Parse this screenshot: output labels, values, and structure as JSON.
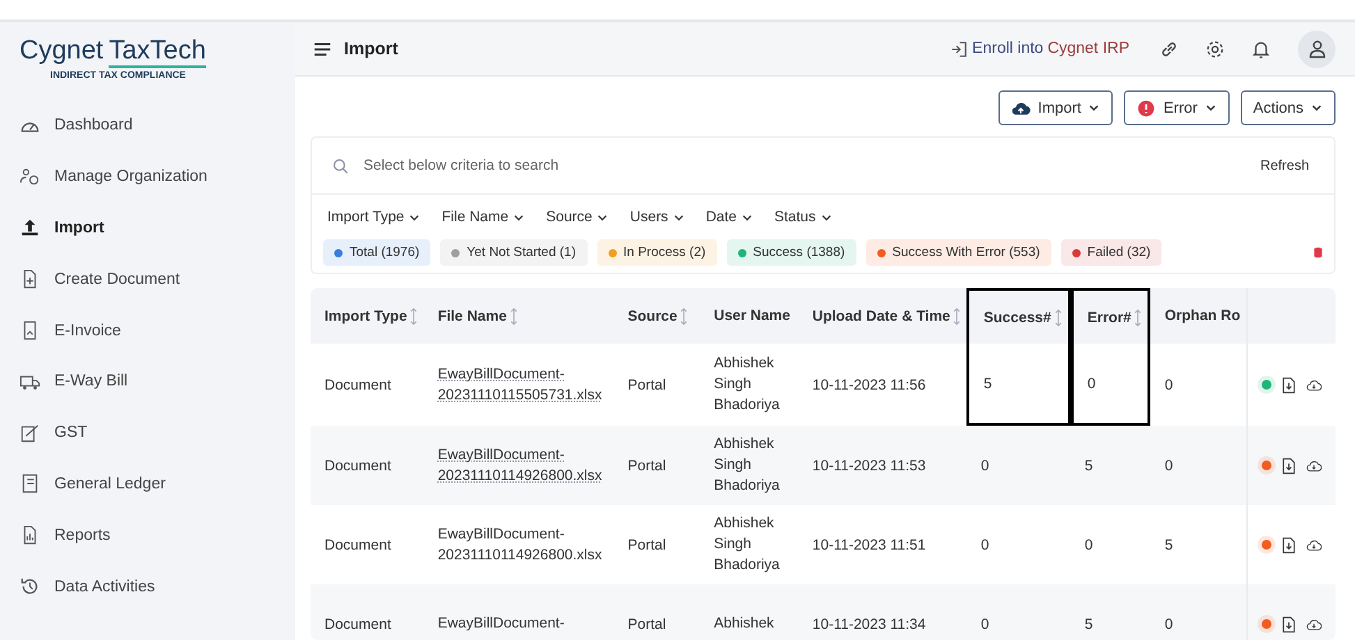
{
  "brand": {
    "name_dark": "Cygnet",
    "name_light": "TaxTech",
    "tagline": "INDIRECT TAX COMPLIANCE"
  },
  "sidebar": {
    "items": [
      {
        "label": "Dashboard",
        "selected": false
      },
      {
        "label": "Manage Organization",
        "selected": false
      },
      {
        "label": "Import",
        "selected": true
      },
      {
        "label": "Create Document",
        "selected": false
      },
      {
        "label": "E-Invoice",
        "selected": false
      },
      {
        "label": "E-Way Bill",
        "selected": false
      },
      {
        "label": "GST",
        "selected": false
      },
      {
        "label": "General Ledger",
        "selected": false
      },
      {
        "label": "Reports",
        "selected": false
      },
      {
        "label": "Data Activities",
        "selected": false
      }
    ]
  },
  "header": {
    "title": "Import",
    "enroll_prefix": "Enroll into",
    "enroll_brand": "Cygnet IRP"
  },
  "toolbar": {
    "buttons": [
      {
        "label": "Import",
        "kind": "upload"
      },
      {
        "label": "Error",
        "kind": "error"
      },
      {
        "label": "Actions",
        "kind": "plain"
      }
    ]
  },
  "search": {
    "placeholder": "Select below criteria to search",
    "refresh": "Refresh"
  },
  "filters": [
    "Import Type",
    "File Name",
    "Source",
    "Users",
    "Date",
    "Status"
  ],
  "chips": [
    {
      "label": "Total (1976)",
      "color": "#3b7ddd"
    },
    {
      "label": "Yet Not Started (1)",
      "color": "#9e9e9e"
    },
    {
      "label": "In Process (2)",
      "color": "#f0a020"
    },
    {
      "label": "Success (1388)",
      "color": "#1db57a"
    },
    {
      "label": "Success With Error (553)",
      "color": "#f25c1f"
    },
    {
      "label": "Failed (32)",
      "color": "#d63a3a"
    }
  ],
  "table": {
    "columns": [
      {
        "label": "Import Type",
        "sortable": true,
        "highlighted": false
      },
      {
        "label": "File Name",
        "sortable": true,
        "highlighted": false
      },
      {
        "label": "Source",
        "sortable": true,
        "highlighted": false
      },
      {
        "label": "User Name",
        "sortable": false,
        "highlighted": false
      },
      {
        "label": "Upload Date & Time",
        "sortable": true,
        "highlighted": false
      },
      {
        "label": "Success#",
        "sortable": true,
        "highlighted": true
      },
      {
        "label": "Error#",
        "sortable": true,
        "highlighted": true
      },
      {
        "label": "Orphan Ro",
        "sortable": false,
        "highlighted": false
      }
    ],
    "rows": [
      {
        "cells": [
          "Document",
          "EwayBillDocument-20231110115505731.xlsx",
          "Portal",
          "Abhishek Singh Bhadoriya",
          "10-11-2023 11:56",
          "5",
          "0",
          "0"
        ],
        "link": true,
        "color": "#1db57a"
      },
      {
        "cells": [
          "Document",
          "EwayBillDocument-20231110114926800.xlsx",
          "Portal",
          "Abhishek Singh Bhadoriya",
          "10-11-2023 11:53",
          "0",
          "5",
          "0"
        ],
        "link": true,
        "color": "#f25c1f"
      },
      {
        "cells": [
          "Document",
          "EwayBillDocument-20231110114926800.xlsx",
          "Portal",
          "Abhishek Singh Bhadoriya",
          "10-11-2023 11:51",
          "0",
          "0",
          "5"
        ],
        "link": false,
        "color": "#f25c1f"
      },
      {
        "cells": [
          "Document",
          "EwayBillDocument-",
          "Portal",
          "Abhishek",
          "10-11-2023 11:34",
          "0",
          "5",
          "0"
        ],
        "link": false,
        "color": "#f25c1f"
      }
    ]
  }
}
